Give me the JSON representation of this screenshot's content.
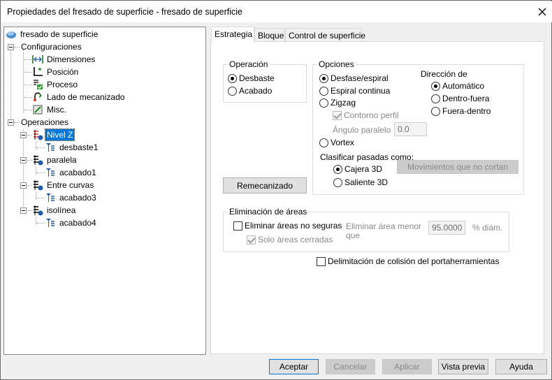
{
  "window": {
    "title": "Propiedades del fresado de superficie - fresado de superficie"
  },
  "tree": {
    "root": "fresado de superficie",
    "configuraciones": {
      "label": "Configuraciones",
      "items": [
        "Dimensiones",
        "Posición",
        "Proceso",
        "Lado de mecanizado",
        "Misc."
      ]
    },
    "operaciones": {
      "label": "Operaciones",
      "items": [
        {
          "label": "Nivel Z",
          "child": "desbaste1",
          "selected": true
        },
        {
          "label": "paralela",
          "child": "acabado1"
        },
        {
          "label": "Entre curvas",
          "child": "acabado3"
        },
        {
          "label": "isolínea",
          "child": "acabado4"
        }
      ]
    }
  },
  "tabs": [
    "Estrategia",
    "Bloque",
    "Control de superficie"
  ],
  "operacion": {
    "title": "Operación",
    "options": [
      "Desbaste",
      "Acabado"
    ],
    "selected": 0
  },
  "opciones": {
    "title": "Opciones",
    "options": [
      "Desfase/espiral",
      "Espiral continua",
      "Zigzag",
      "Vortex"
    ],
    "selected": 0,
    "contorno_perfil": "Contorno perfil",
    "angulo_label": "Ángulo paralelo",
    "angulo_value": "0.0",
    "direccion": {
      "title": "Dirección de",
      "options": [
        "Automático",
        "Dentro-fuera",
        "Fuera-dentro"
      ],
      "selected": 0
    },
    "clasificar": {
      "title": "Clasificar pasadas como:",
      "options": [
        "Cajera 3D",
        "Saliente 3D"
      ],
      "selected": 0
    },
    "movimientos_button": "Movimientos que no cortan"
  },
  "remecanizado_button": "Remecanizado",
  "eliminacion": {
    "title": "Eliminación de áreas",
    "eliminar_check": "Eliminar áreas no seguras",
    "solo_check": "Solo áreas cerradas",
    "menor_label_1": "Eliminar área menor",
    "menor_label_2": "que",
    "menor_value": "95.0000",
    "unit": "% diám."
  },
  "delimitacion_check": "Delimitación de colisión del portaherramientas",
  "buttons": {
    "accept": "Aceptar",
    "cancel": "Cancelar",
    "apply": "Aplicar",
    "preview": "Vista previa",
    "help": "Ayuda"
  },
  "colors": {
    "selection": "#0078d7",
    "accent_red": "#d43a2f",
    "tool_blue": "#1f5ca8"
  }
}
